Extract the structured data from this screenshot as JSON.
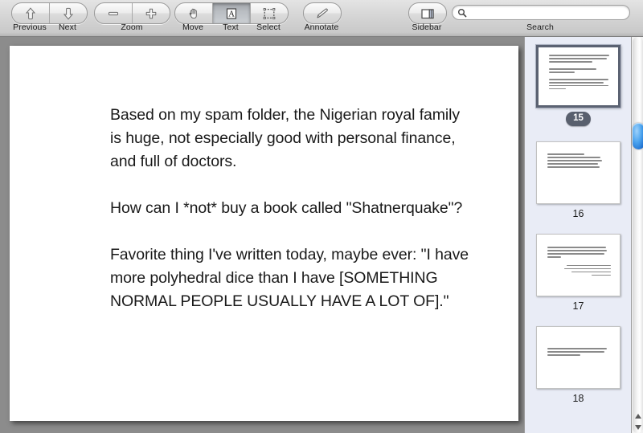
{
  "toolbar": {
    "groups": [
      {
        "name": "navigation",
        "buttons": [
          {
            "label": "Previous",
            "icon": "arrow-up-icon"
          },
          {
            "label": "Next",
            "icon": "arrow-down-icon"
          }
        ]
      },
      {
        "name": "zoom",
        "group_label": "Zoom",
        "buttons": [
          {
            "label": "Zoom Out",
            "icon": "minus-icon"
          },
          {
            "label": "Zoom In",
            "icon": "plus-icon"
          }
        ]
      },
      {
        "name": "tools",
        "buttons": [
          {
            "label": "Move",
            "icon": "hand-icon",
            "selected": false
          },
          {
            "label": "Text",
            "icon": "text-a-icon",
            "selected": true
          },
          {
            "label": "Select",
            "icon": "marquee-select-icon",
            "selected": false
          }
        ]
      },
      {
        "name": "annotate",
        "buttons": [
          {
            "label": "Annotate",
            "icon": "pencil-icon"
          }
        ]
      },
      {
        "name": "sidebar",
        "buttons": [
          {
            "label": "Sidebar",
            "icon": "sidebar-panel-icon"
          }
        ]
      }
    ],
    "search": {
      "label": "Search",
      "icon": "search-icon",
      "value": "",
      "placeholder": ""
    }
  },
  "document": {
    "paragraphs": [
      "Based on my spam folder, the Nigerian royal family is huge, not especially good with personal finance, and full of doctors.",
      "How can I *not* buy a book called \"Shatnerquake\"?",
      "Favorite thing I've written today, maybe ever: \"I have more polyhedral dice than I have [SOMETHING NORMAL PEOPLE USUALLY HAVE A LOT OF].\""
    ]
  },
  "sidebar": {
    "thumbnails": [
      {
        "page_number": "15",
        "selected": true,
        "preview_text": "Based on my spam folder, the Nigerian royal family is huge, not especially good with personal finance, and full of doctors. How can I *not* buy a book called \"Shatnerquake\"? Favorite thing I've written today, maybe ever: \"I have more polyhedral dice than I have [SOMETHING NORMAL PEOPLE USUALLY HAVE A LOT OF].\""
      },
      {
        "page_number": "16",
        "selected": false,
        "preview_text": "I just slipped and waterboarded myself with my Neti pot. In the ensuing confessions, it turns out that I killed Lincoln and shot JFK."
      },
      {
        "page_number": "17",
        "selected": false,
        "preview_text": "Two text blocks, the second right-aligned."
      },
      {
        "page_number": "18",
        "selected": false,
        "preview_text": "Single short text block near the top of the page."
      }
    ]
  },
  "scrollbar": {
    "name": "sidebar-scrollbar",
    "up_arrow": "scroll-up-arrow",
    "down_arrow": "scroll-down-arrow"
  }
}
